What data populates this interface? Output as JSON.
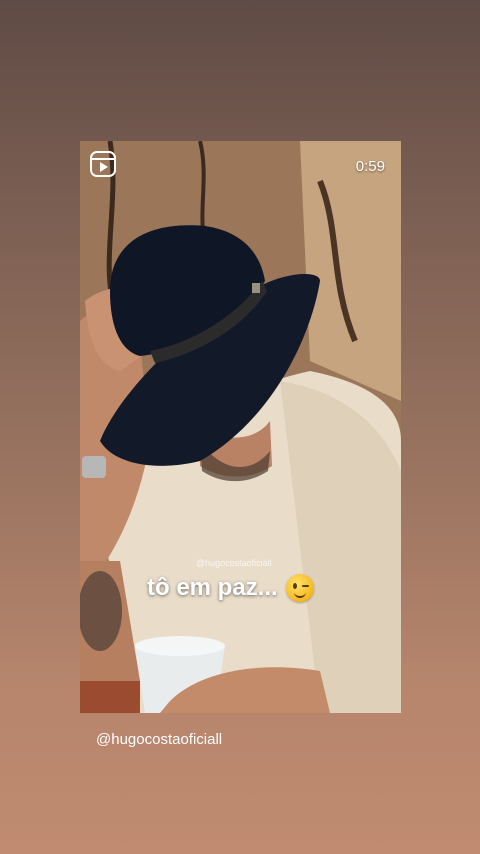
{
  "reel": {
    "icon": "reels-icon",
    "duration": "0:59",
    "watermark": "@hugocostaoficiall",
    "caption": "tô em paz...",
    "caption_emoji": "winking-face-emoji"
  },
  "footer": {
    "handle": "@hugocostaoficiall"
  },
  "colors": {
    "text": "#ffffff",
    "background_top": "#5f4b45",
    "background_bottom": "#c08b70"
  }
}
